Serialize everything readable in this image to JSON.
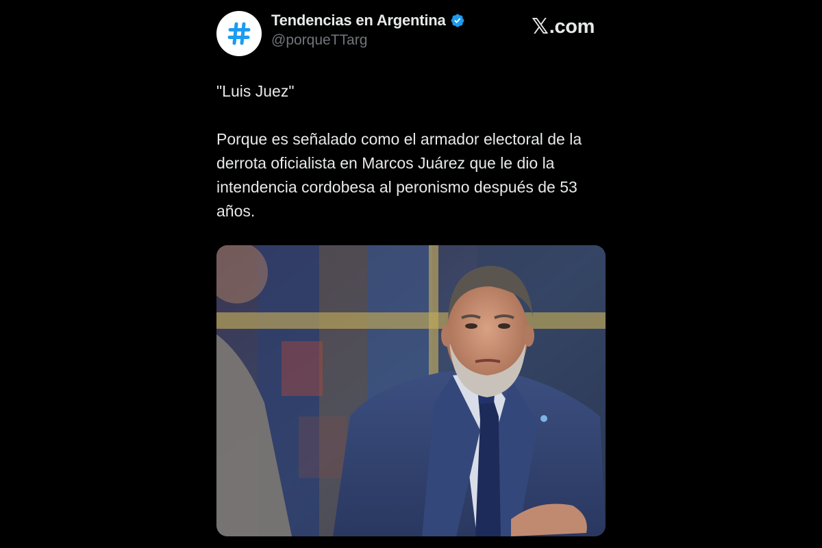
{
  "account": {
    "display_name": "Tendencias en Argentina",
    "handle": "@porqueTTarg",
    "avatar_icon": "hashtag-icon",
    "avatar_symbol": "#",
    "verified": true,
    "verified_color": "#1d9bf0"
  },
  "brand": {
    "x_glyph": "𝕏",
    "suffix": ".com"
  },
  "tweet": {
    "quote": "\"Luis Juez\"",
    "body": "Porque es señalado como el armador electoral de la derrota oficialista en Marcos Juárez que le dio la intendencia cordobesa al peronismo después de 53 años."
  },
  "media": {
    "type": "photo"
  },
  "colors": {
    "background": "#000000",
    "text_primary": "#e7e9ea",
    "text_secondary": "#71767b",
    "accent": "#1d9bf0"
  }
}
